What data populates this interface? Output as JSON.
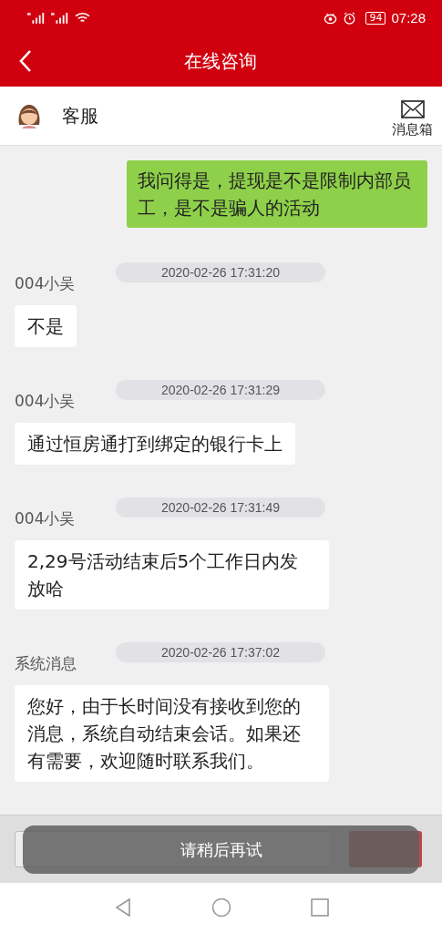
{
  "status_bar": {
    "battery": "94",
    "time": "07:28"
  },
  "header": {
    "title": "在线咨询"
  },
  "contact": {
    "name": "客服",
    "mailbox_label": "消息箱"
  },
  "messages": [
    {
      "kind": "sent",
      "text": "我问得是，提现是不是限制内部员工，是不是骗人的活动"
    },
    {
      "kind": "received",
      "sender": "004小吴",
      "time": "2020-02-26 17:31:20",
      "text": "不是"
    },
    {
      "kind": "received",
      "sender": "004小吴",
      "time": "2020-02-26 17:31:29",
      "text": "通过恒房通打到绑定的银行卡上"
    },
    {
      "kind": "received",
      "sender": "004小吴",
      "time": "2020-02-26 17:31:49",
      "text": "2,29号活动结束后5个工作日内发放哈"
    },
    {
      "kind": "received",
      "sender": "系统消息",
      "time": "2020-02-26 17:37:02",
      "text": "您好，由于长时间没有接收到您的消息，系统自动结束会话。如果还有需要，欢迎随时联系我们。"
    }
  ],
  "toast": {
    "text": "请稍后再试"
  }
}
